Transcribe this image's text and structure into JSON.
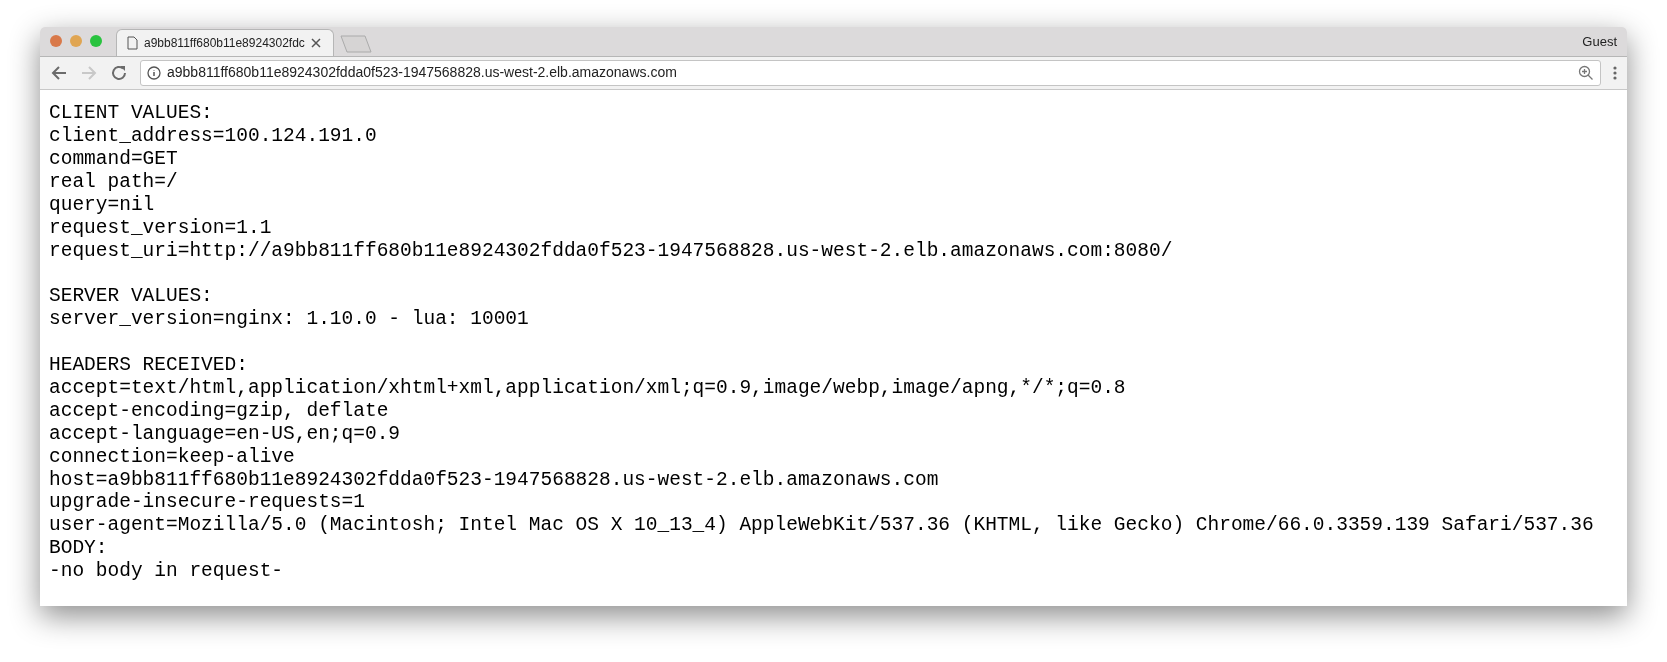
{
  "tab": {
    "title": "a9bb811ff680b11e8924302fdc",
    "selected": true
  },
  "profile": "Guest",
  "nav": [
    {
      "kind": "back",
      "disabled": false
    },
    {
      "kind": "forward",
      "disabled": true
    },
    {
      "kind": "reload",
      "disabled": false
    }
  ],
  "address_bar": {
    "value": "a9bb811ff680b11e8924302fdda0f523-1947568828.us-west-2.elb.amazonaws.com"
  },
  "paragraphs": [
    {
      "lines": [
        "CLIENT VALUES:",
        "client_address=100.124.191.0",
        "command=GET",
        "real path=/",
        "query=nil",
        "request_version=1.1",
        "request_uri=http://a9bb811ff680b11e8924302fdda0f523-1947568828.us-west-2.elb.amazonaws.com:8080/"
      ]
    },
    {
      "lines": [
        "SERVER VALUES:",
        "server_version=nginx: 1.10.0 - lua: 10001"
      ]
    },
    {
      "lines": [
        "HEADERS RECEIVED:",
        "accept=text/html,application/xhtml+xml,application/xml;q=0.9,image/webp,image/apng,*/*;q=0.8",
        "accept-encoding=gzip, deflate",
        "accept-language=en-US,en;q=0.9",
        "connection=keep-alive",
        "host=a9bb811ff680b11e8924302fdda0f523-1947568828.us-west-2.elb.amazonaws.com",
        "upgrade-insecure-requests=1",
        "user-agent=Mozilla/5.0 (Macintosh; Intel Mac OS X 10_13_4) AppleWebKit/537.36 (KHTML, like Gecko) Chrome/66.0.3359.139 Safari/537.36",
        "BODY:",
        "-no body in request-"
      ]
    }
  ]
}
